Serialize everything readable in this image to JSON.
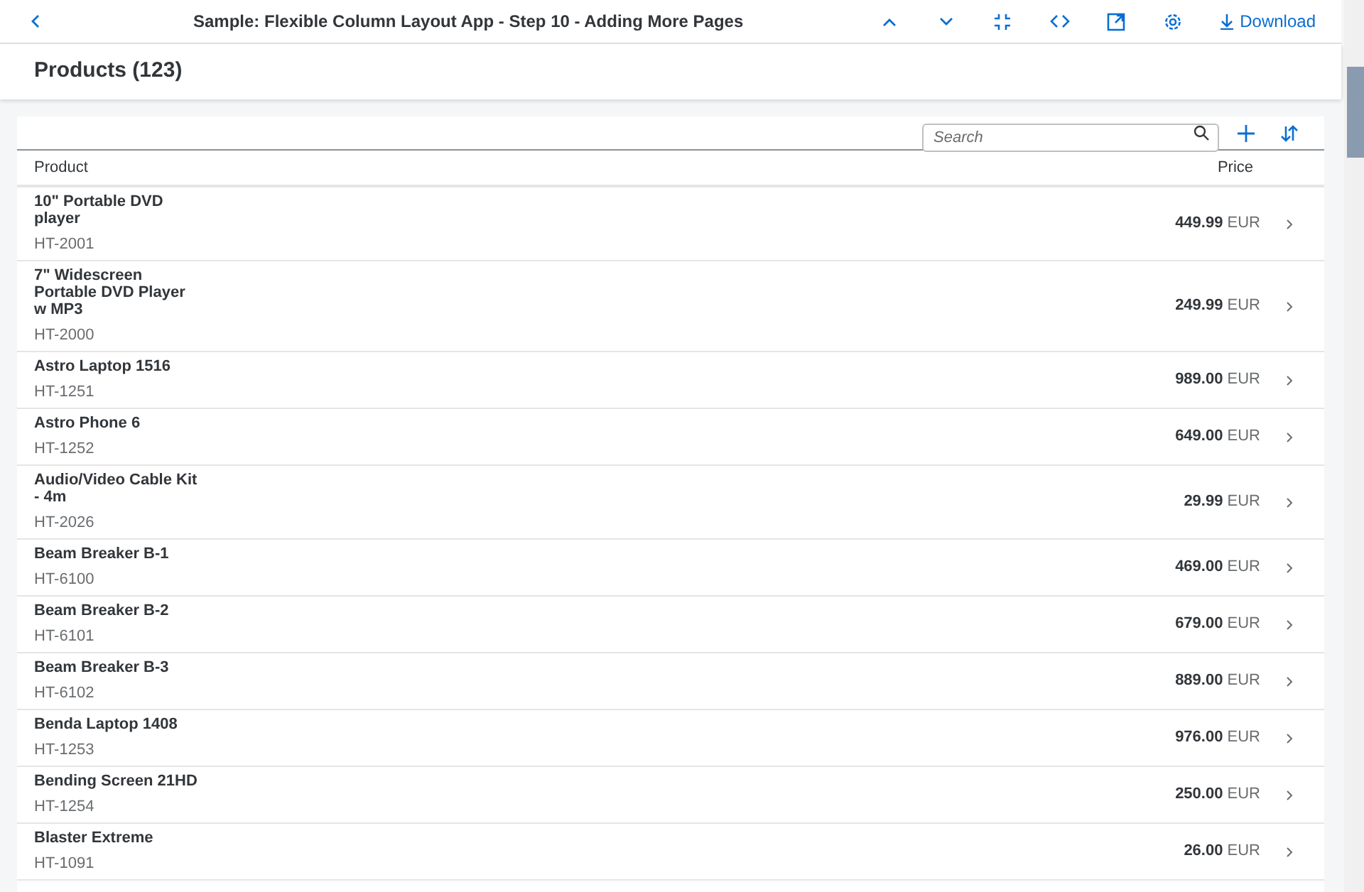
{
  "header": {
    "title": "Sample: Flexible Column Layout App - Step 10 - Adding More Pages",
    "download": "Download"
  },
  "page": {
    "title": "Products (123)"
  },
  "toolbar": {
    "search": {
      "placeholder": "Search"
    }
  },
  "table": {
    "columns": [
      "Product",
      "Price"
    ],
    "rows": [
      {
        "name": "10\" Portable DVD player",
        "id": "HT-2001",
        "price": "449.99",
        "currency": "EUR"
      },
      {
        "name": "7\" Widescreen Portable DVD Player w MP3",
        "id": "HT-2000",
        "price": "249.99",
        "currency": "EUR"
      },
      {
        "name": "Astro Laptop 1516",
        "id": "HT-1251",
        "price": "989.00",
        "currency": "EUR"
      },
      {
        "name": "Astro Phone 6",
        "id": "HT-1252",
        "price": "649.00",
        "currency": "EUR"
      },
      {
        "name": "Audio/Video Cable Kit - 4m",
        "id": "HT-2026",
        "price": "29.99",
        "currency": "EUR"
      },
      {
        "name": "Beam Breaker B-1",
        "id": "HT-6100",
        "price": "469.00",
        "currency": "EUR"
      },
      {
        "name": "Beam Breaker B-2",
        "id": "HT-6101",
        "price": "679.00",
        "currency": "EUR"
      },
      {
        "name": "Beam Breaker B-3",
        "id": "HT-6102",
        "price": "889.00",
        "currency": "EUR"
      },
      {
        "name": "Benda Laptop 1408",
        "id": "HT-1253",
        "price": "976.00",
        "currency": "EUR"
      },
      {
        "name": "Bending Screen 21HD",
        "id": "HT-1254",
        "price": "250.00",
        "currency": "EUR"
      },
      {
        "name": "Blaster Extreme",
        "id": "HT-1091",
        "price": "26.00",
        "currency": "EUR"
      }
    ]
  }
}
